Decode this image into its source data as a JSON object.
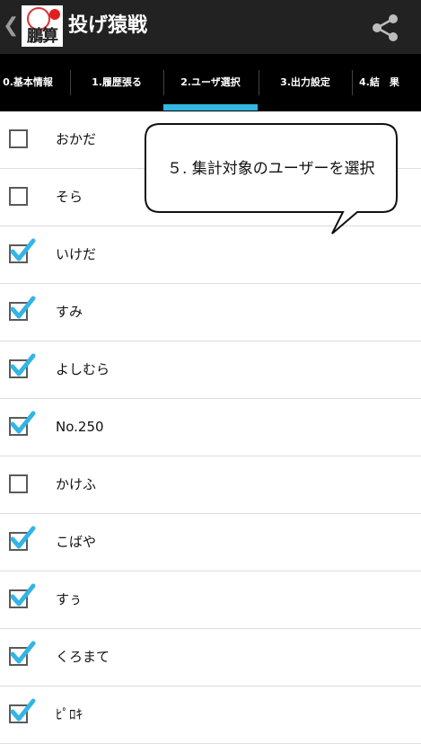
{
  "actionbar": {
    "back_glyph": "❮",
    "logo_text": "鵬算",
    "title": "投げ猿戦",
    "share_icon": "share-icon"
  },
  "tabs": [
    {
      "label": "0.基本情報"
    },
    {
      "label": "1.履歴張る"
    },
    {
      "label": "2.ユーザ選択",
      "selected": true
    },
    {
      "label": "3.出力設定"
    },
    {
      "label": "4.結　果"
    }
  ],
  "accent_color": "#33b5e5",
  "callout": {
    "text": "５. 集計対象のユーザーを選択"
  },
  "users": [
    {
      "name": "おかだ",
      "checked": false
    },
    {
      "name": "そら",
      "checked": false
    },
    {
      "name": "いけだ",
      "checked": true
    },
    {
      "name": "すみ",
      "checked": true
    },
    {
      "name": "よしむら",
      "checked": true
    },
    {
      "name": "No.250",
      "checked": true
    },
    {
      "name": "かけふ",
      "checked": false
    },
    {
      "name": "こばや",
      "checked": true
    },
    {
      "name": "すぅ",
      "checked": true
    },
    {
      "name": "くろまて",
      "checked": true
    },
    {
      "name": "ﾋﾟﾛｷ",
      "checked": true
    }
  ]
}
